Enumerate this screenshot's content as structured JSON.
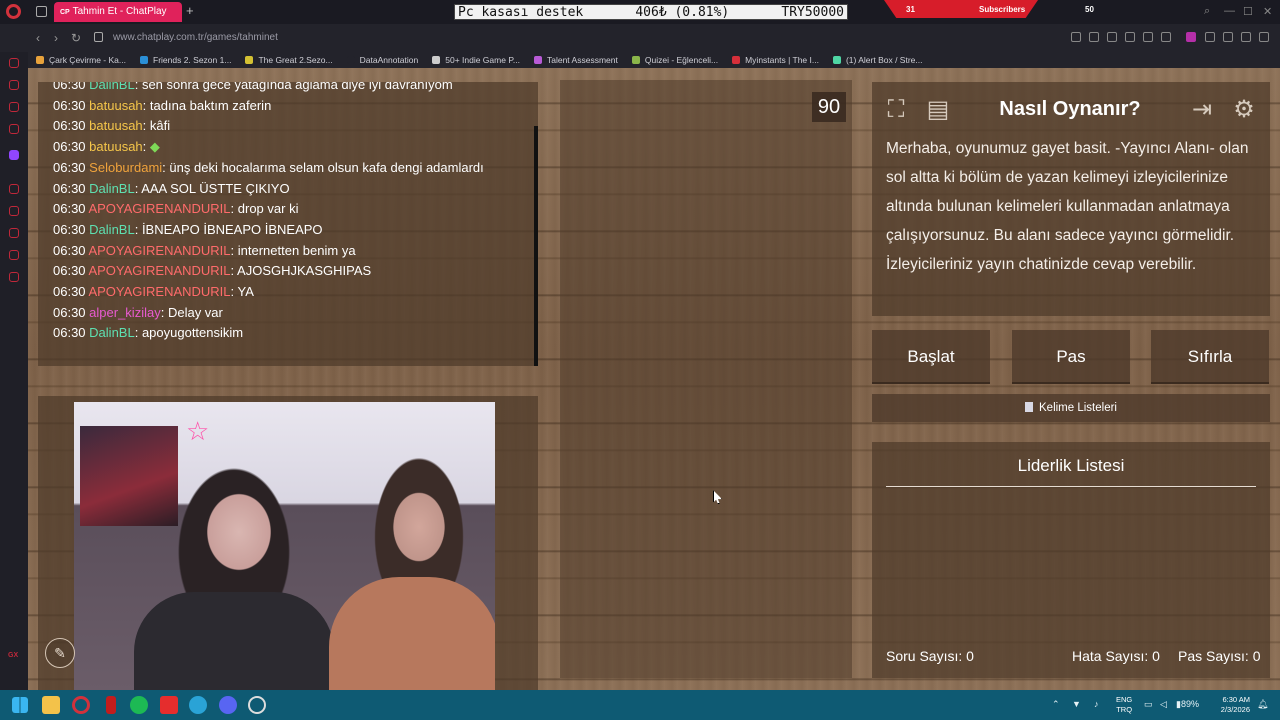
{
  "browser": {
    "tab_title": "Tahmin Et - ChatPlay",
    "tab_favicon": "CP",
    "url": "www.chatplay.com.tr/games/tahminet",
    "bookmarks": [
      {
        "label": "Çark Çevirme - Ka...",
        "color": "#e8a23b"
      },
      {
        "label": "Friends 2. Sezon 1...",
        "color": "#2b8fd6"
      },
      {
        "label": "The Great 2.Sezo...",
        "color": "#d4c133"
      },
      {
        "label": "DataAnnotation",
        "color": "#23232b"
      },
      {
        "label": "50+ Indie Game P...",
        "color": "#cccccc"
      },
      {
        "label": "Talent Assessment",
        "color": "#b85ad6"
      },
      {
        "label": "Quizei - Eğlenceli...",
        "color": "#8bb54a"
      },
      {
        "label": "Myinstants | The I...",
        "color": "#d62f3a"
      },
      {
        "label": "(1) Alert Box / Stre...",
        "color": "#4fd6a4"
      }
    ]
  },
  "overlay": {
    "ticker_left": "Pc kasası destek",
    "ticker_mid": "406₺ (0.81%)",
    "ticker_right": "TRY50000",
    "subs_count": "31",
    "subs_label": "Subscribers",
    "subs_goal": "50"
  },
  "chat": {
    "messages": [
      {
        "time": "06:30",
        "user": "DalinBL",
        "color": "#5ee0b1",
        "text": "sen sonra gece yatağında ağlama diye iyi davranıyom"
      },
      {
        "time": "06:30",
        "user": "batuusah",
        "color": "#f5c64a",
        "text": "tadına baktım zaferin"
      },
      {
        "time": "06:30",
        "user": "batuusah",
        "color": "#f5c64a",
        "text": "kâfi"
      },
      {
        "time": "06:30",
        "user": "batuusah",
        "color": "#f5c64a",
        "text": ""
      },
      {
        "time": "06:30",
        "user": "Seloburdami",
        "color": "#f0a33c",
        "text": "ünş deki hocalarıma selam olsun kafa dengi adamlardı"
      },
      {
        "time": "06:30",
        "user": "DalinBL",
        "color": "#5ee0b1",
        "text": "AAA SOL ÜSTTE ÇIKIYO"
      },
      {
        "time": "06:30",
        "user": "APOYAGIRENANDURIL",
        "color": "#ff6b6b",
        "text": "drop var ki"
      },
      {
        "time": "06:30",
        "user": "DalinBL",
        "color": "#5ee0b1",
        "text": "İBNEAPO İBNEAPO İBNEAPO"
      },
      {
        "time": "06:30",
        "user": "APOYAGIRENANDURIL",
        "color": "#ff6b6b",
        "text": "internetten benim ya"
      },
      {
        "time": "06:30",
        "user": "APOYAGIRENANDURIL",
        "color": "#ff6b6b",
        "text": "AJOSGHJKASGHIPAS"
      },
      {
        "time": "06:30",
        "user": "APOYAGIRENANDURIL",
        "color": "#ff6b6b",
        "text": "YA"
      },
      {
        "time": "06:30",
        "user": "alper_kizilay",
        "color": "#e85ad0",
        "text": "Delay var"
      },
      {
        "time": "06:30",
        "user": "DalinBL",
        "color": "#5ee0b1",
        "text": "apoyugottensikim"
      }
    ]
  },
  "game": {
    "timer": "90",
    "howto_title": "Nasıl Oynanır?",
    "howto_text": "Merhaba, oyunumuz gayet basit. -Yayıncı Alanı- olan sol altta ki bölüm de yazan kelimeyi izleyicilerinize altında bulunan kelimeleri kullanmadan anlatmaya çalışıyorsunuz. Bu alanı sadece yayıncı görmelidir. İzleyicileriniz yayın chatinizde cevap verebilir.",
    "buttons": {
      "start": "Başlat",
      "pass": "Pas",
      "reset": "Sıfırla"
    },
    "word_lists": "Kelime Listeleri",
    "leaderboard_title": "Liderlik Listesi",
    "stats": {
      "questions_label": "Soru Sayısı:",
      "questions_value": "0",
      "errors_label": "Hata Sayısı:",
      "errors_value": "0",
      "passes_label": "Pas Sayısı:",
      "passes_value": "0"
    }
  },
  "taskbar": {
    "lang_top": "ENG",
    "lang_bottom": "TRQ",
    "battery": "89%",
    "time": "6:30 AM",
    "date": "2/3/2026"
  }
}
